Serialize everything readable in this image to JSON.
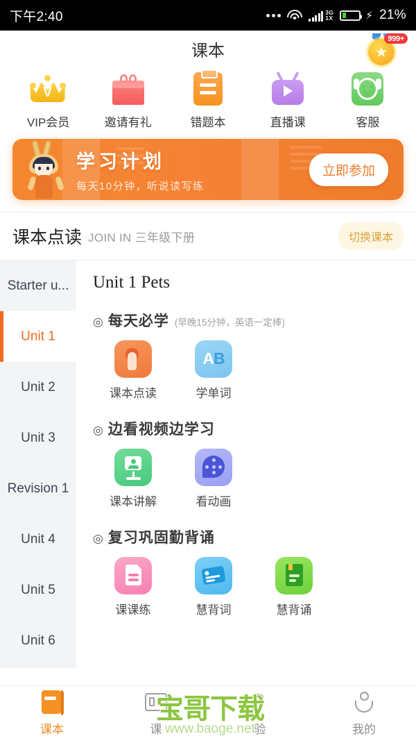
{
  "status_bar": {
    "time": "下午2:40",
    "network_type_top": "3G",
    "network_type_bottom": "1X",
    "battery_percent": "21%",
    "icons": [
      "more-dots-icon",
      "wifi-icon",
      "signal-bars-icon",
      "battery-icon",
      "charging-bolt-icon"
    ]
  },
  "header": {
    "title": "课本",
    "medal_badge_count": "999+",
    "medal_icon": "medal-star-icon"
  },
  "quick_actions": [
    {
      "label": "VIP会员",
      "icon": "crown-icon",
      "color": "#f2b417"
    },
    {
      "label": "邀请有礼",
      "icon": "gift-icon",
      "color": "#f45b5b"
    },
    {
      "label": "错题本",
      "icon": "clipboard-icon",
      "color": "#f7921f"
    },
    {
      "label": "直播课",
      "icon": "tv-play-icon",
      "color": "#b87ce8"
    },
    {
      "label": "客服",
      "icon": "headset-face-icon",
      "color": "#62c95f"
    }
  ],
  "banner": {
    "title": "学习计划",
    "subtitle": "每天10分钟，听说读写练",
    "button_label": "立即参加",
    "bg_color": "#f58235",
    "mascot_icon": "rabbit-mascot-icon"
  },
  "textbook_section": {
    "title": "课本点读",
    "subtitle": "JOIN IN 三年级下册",
    "switch_button_label": "切换课本"
  },
  "sidebar": {
    "items": [
      {
        "label": "Starter u...",
        "active": false
      },
      {
        "label": "Unit 1",
        "active": true
      },
      {
        "label": "Unit 2",
        "active": false
      },
      {
        "label": "Unit 3",
        "active": false
      },
      {
        "label": "Revision 1",
        "active": false
      },
      {
        "label": "Unit 4",
        "active": false
      },
      {
        "label": "Unit 5",
        "active": false
      },
      {
        "label": "Unit 6",
        "active": false
      }
    ],
    "accent_color": "#ef6c23"
  },
  "content": {
    "unit_title": "Unit 1  Pets",
    "groups": [
      {
        "mark": "◎",
        "title": "每天必学",
        "note": "(早晚15分钟，英语一定棒)",
        "tiles": [
          {
            "label": "课本点读",
            "icon": "tap-to-read-icon"
          },
          {
            "label": "学单词",
            "icon": "ab-letters-icon"
          }
        ]
      },
      {
        "mark": "◎",
        "title": "边看视频边学习",
        "note": "",
        "tiles": [
          {
            "label": "课本讲解",
            "icon": "teacher-presentation-icon"
          },
          {
            "label": "看动画",
            "icon": "film-reel-icon"
          }
        ]
      },
      {
        "mark": "◎",
        "title": "复习巩固勤背诵",
        "note": "",
        "tiles": [
          {
            "label": "课课练",
            "icon": "exercise-doc-icon"
          },
          {
            "label": "慧背词",
            "icon": "word-card-icon"
          },
          {
            "label": "慧背诵",
            "icon": "green-book-icon"
          }
        ]
      }
    ]
  },
  "tabbar": {
    "items": [
      {
        "label": "课本",
        "icon": "book-icon",
        "active": true
      },
      {
        "label": "课",
        "icon": "card-icon",
        "active": false
      },
      {
        "label": "验",
        "icon": "pen-icon",
        "active": false
      },
      {
        "label": "我的",
        "icon": "person-icon",
        "active": false
      }
    ],
    "active_color": "#ef8a22"
  },
  "watermark": {
    "text": "宝哥下载",
    "url": "www.baoge.net",
    "color": "#8cc63f"
  }
}
